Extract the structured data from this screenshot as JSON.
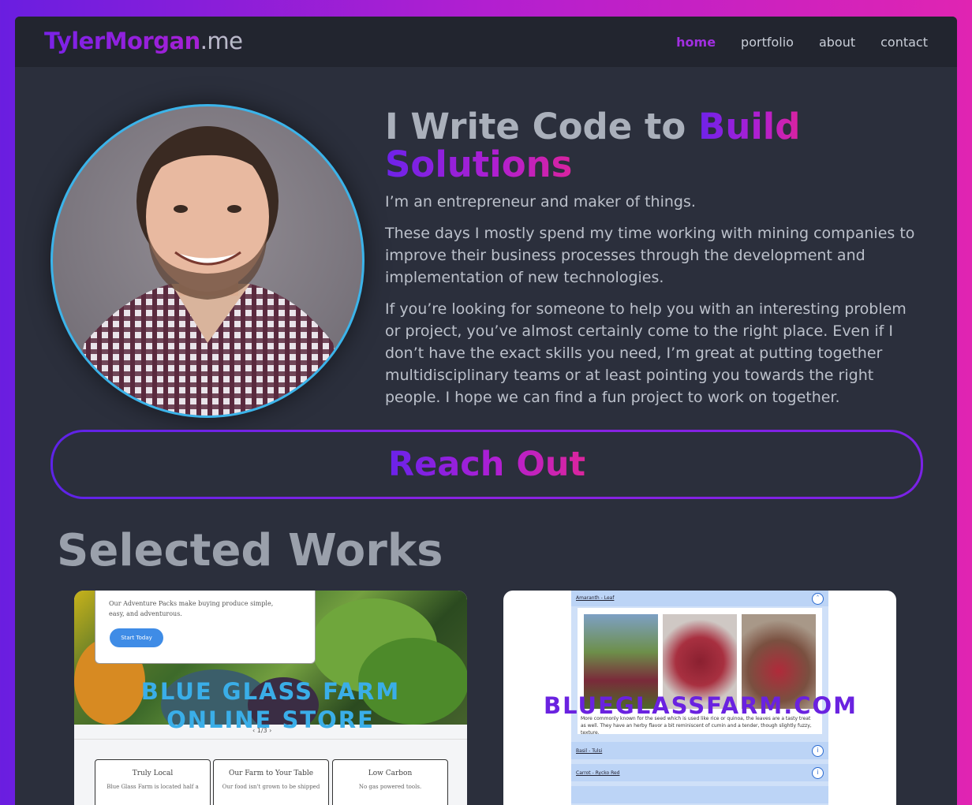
{
  "brand": {
    "name": "TylerMorgan",
    "tld": ".me"
  },
  "nav": [
    {
      "label": "home",
      "active": true
    },
    {
      "label": "portfolio",
      "active": false
    },
    {
      "label": "about",
      "active": false
    },
    {
      "label": "contact",
      "active": false
    }
  ],
  "hero": {
    "headline_plain": "I Write Code to ",
    "headline_accent_1": "Build",
    "headline_accent_2": "Solutions",
    "bio": [
      "I’m an entrepreneur and maker of things.",
      "These days I mostly spend my time working with mining companies to improve their business processes through the development and implementation of new technologies.",
      "If you’re looking for someone to help you with an interesting problem or project, you’ve almost certainly come to the right place. Even if I don’t have the exact skills you need, I’m great at putting together multidisciplinary teams or at least pointing you towards the right people. I hope we can find a fun project to work on together."
    ]
  },
  "reach_out": "Reach Out",
  "works": {
    "title": "Selected Works",
    "items": [
      {
        "label": "BLUE GLASS FARM ONLINE STORE",
        "popup_text": "Our Adventure Packs make buying produce simple, easy, and adventurous.",
        "popup_button": "Start Today",
        "pager": "‹ 1/3 ›",
        "features": [
          {
            "title": "Truly Local",
            "desc": "Blue Glass Farm is located half a"
          },
          {
            "title": "Our Farm to Your Table",
            "desc": "Our food isn't grown to be shipped"
          },
          {
            "title": "Low Carbon",
            "desc": "No gas powered tools."
          }
        ]
      },
      {
        "label": "BLUEGLASSFARM.COM",
        "accordion_open": "Amaranth - Leaf",
        "description": "More commonly known for the seed which is used like rice or quinoa, the leaves are a tasty treat as well. They have an herby flavor a bit reminiscent of cumin and a tender, though slightly fuzzy, texture.",
        "rows": [
          "Basil - Tulsi",
          "Carrot - Rycko Red"
        ]
      }
    ]
  },
  "colors": {
    "accent_purple": "#6d22ea",
    "accent_pink": "#d9239f",
    "avatar_ring": "#3bb4ea",
    "bg": "#2b2f3c"
  }
}
